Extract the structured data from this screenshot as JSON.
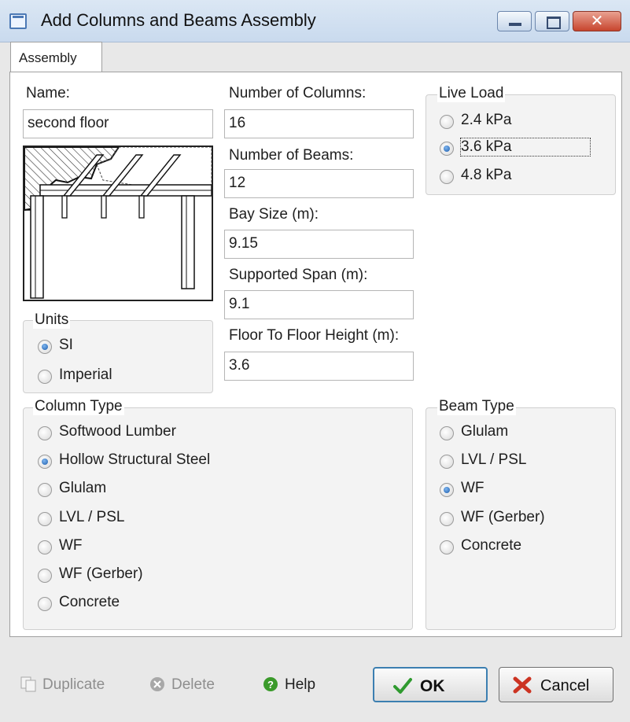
{
  "window": {
    "title": "Add  Columns and Beams Assembly",
    "close_glyph": "✕"
  },
  "tab": {
    "label": "Assembly"
  },
  "name": {
    "label": "Name:",
    "value": "second floor"
  },
  "columns": {
    "label": "Number of Columns:",
    "value": "16"
  },
  "beams": {
    "label": "Number of Beams:",
    "value": "12"
  },
  "bay": {
    "label": "Bay Size (m):",
    "value": "9.15"
  },
  "span": {
    "label": "Supported Span (m):",
    "value": "9.1"
  },
  "height": {
    "label": "Floor To Floor Height (m):",
    "value": "3.6"
  },
  "live_load": {
    "title": "Live Load",
    "options": [
      "2.4 kPa",
      "3.6 kPa",
      "4.8 kPa"
    ],
    "selected": "3.6 kPa"
  },
  "units": {
    "title": "Units",
    "options": [
      "SI",
      "Imperial"
    ],
    "selected": "SI"
  },
  "column_type": {
    "title": "Column Type",
    "options": [
      "Softwood Lumber",
      "Hollow Structural Steel",
      "Glulam",
      "LVL / PSL",
      "WF",
      "WF (Gerber)",
      "Concrete"
    ],
    "selected": "Hollow Structural Steel"
  },
  "beam_type": {
    "title": "Beam Type",
    "options": [
      "Glulam",
      "LVL / PSL",
      "WF",
      "WF (Gerber)",
      "Concrete"
    ],
    "selected": "WF"
  },
  "footer": {
    "duplicate": "Duplicate",
    "delete": "Delete",
    "help": "Help",
    "ok": "OK",
    "cancel": "Cancel"
  },
  "colors": {
    "ok_accent": "#3c7fb1",
    "check": "#2f9a2f",
    "cancel_x": "#cc3322",
    "help": "#3a9a2a"
  },
  "icons": [
    "window-icon",
    "minimize-icon",
    "maximize-icon",
    "close-icon",
    "duplicate-icon",
    "delete-icon",
    "help-icon",
    "check-icon",
    "x-icon"
  ]
}
